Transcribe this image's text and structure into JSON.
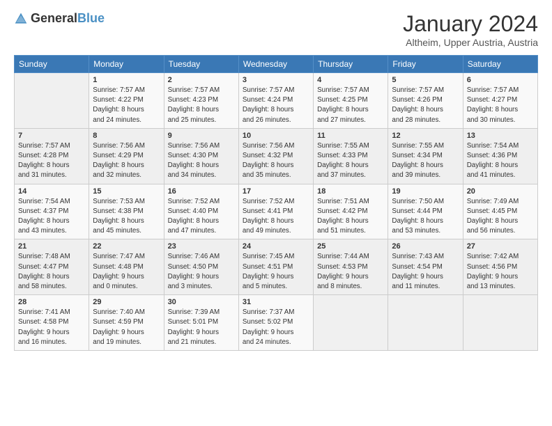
{
  "logo": {
    "general": "General",
    "blue": "Blue"
  },
  "header": {
    "month": "January 2024",
    "location": "Altheim, Upper Austria, Austria"
  },
  "weekdays": [
    "Sunday",
    "Monday",
    "Tuesday",
    "Wednesday",
    "Thursday",
    "Friday",
    "Saturday"
  ],
  "weeks": [
    [
      {
        "day": "",
        "info": ""
      },
      {
        "day": "1",
        "info": "Sunrise: 7:57 AM\nSunset: 4:22 PM\nDaylight: 8 hours\nand 24 minutes."
      },
      {
        "day": "2",
        "info": "Sunrise: 7:57 AM\nSunset: 4:23 PM\nDaylight: 8 hours\nand 25 minutes."
      },
      {
        "day": "3",
        "info": "Sunrise: 7:57 AM\nSunset: 4:24 PM\nDaylight: 8 hours\nand 26 minutes."
      },
      {
        "day": "4",
        "info": "Sunrise: 7:57 AM\nSunset: 4:25 PM\nDaylight: 8 hours\nand 27 minutes."
      },
      {
        "day": "5",
        "info": "Sunrise: 7:57 AM\nSunset: 4:26 PM\nDaylight: 8 hours\nand 28 minutes."
      },
      {
        "day": "6",
        "info": "Sunrise: 7:57 AM\nSunset: 4:27 PM\nDaylight: 8 hours\nand 30 minutes."
      }
    ],
    [
      {
        "day": "7",
        "info": "Sunrise: 7:57 AM\nSunset: 4:28 PM\nDaylight: 8 hours\nand 31 minutes."
      },
      {
        "day": "8",
        "info": "Sunrise: 7:56 AM\nSunset: 4:29 PM\nDaylight: 8 hours\nand 32 minutes."
      },
      {
        "day": "9",
        "info": "Sunrise: 7:56 AM\nSunset: 4:30 PM\nDaylight: 8 hours\nand 34 minutes."
      },
      {
        "day": "10",
        "info": "Sunrise: 7:56 AM\nSunset: 4:32 PM\nDaylight: 8 hours\nand 35 minutes."
      },
      {
        "day": "11",
        "info": "Sunrise: 7:55 AM\nSunset: 4:33 PM\nDaylight: 8 hours\nand 37 minutes."
      },
      {
        "day": "12",
        "info": "Sunrise: 7:55 AM\nSunset: 4:34 PM\nDaylight: 8 hours\nand 39 minutes."
      },
      {
        "day": "13",
        "info": "Sunrise: 7:54 AM\nSunset: 4:36 PM\nDaylight: 8 hours\nand 41 minutes."
      }
    ],
    [
      {
        "day": "14",
        "info": "Sunrise: 7:54 AM\nSunset: 4:37 PM\nDaylight: 8 hours\nand 43 minutes."
      },
      {
        "day": "15",
        "info": "Sunrise: 7:53 AM\nSunset: 4:38 PM\nDaylight: 8 hours\nand 45 minutes."
      },
      {
        "day": "16",
        "info": "Sunrise: 7:52 AM\nSunset: 4:40 PM\nDaylight: 8 hours\nand 47 minutes."
      },
      {
        "day": "17",
        "info": "Sunrise: 7:52 AM\nSunset: 4:41 PM\nDaylight: 8 hours\nand 49 minutes."
      },
      {
        "day": "18",
        "info": "Sunrise: 7:51 AM\nSunset: 4:42 PM\nDaylight: 8 hours\nand 51 minutes."
      },
      {
        "day": "19",
        "info": "Sunrise: 7:50 AM\nSunset: 4:44 PM\nDaylight: 8 hours\nand 53 minutes."
      },
      {
        "day": "20",
        "info": "Sunrise: 7:49 AM\nSunset: 4:45 PM\nDaylight: 8 hours\nand 56 minutes."
      }
    ],
    [
      {
        "day": "21",
        "info": "Sunrise: 7:48 AM\nSunset: 4:47 PM\nDaylight: 8 hours\nand 58 minutes."
      },
      {
        "day": "22",
        "info": "Sunrise: 7:47 AM\nSunset: 4:48 PM\nDaylight: 9 hours\nand 0 minutes."
      },
      {
        "day": "23",
        "info": "Sunrise: 7:46 AM\nSunset: 4:50 PM\nDaylight: 9 hours\nand 3 minutes."
      },
      {
        "day": "24",
        "info": "Sunrise: 7:45 AM\nSunset: 4:51 PM\nDaylight: 9 hours\nand 5 minutes."
      },
      {
        "day": "25",
        "info": "Sunrise: 7:44 AM\nSunset: 4:53 PM\nDaylight: 9 hours\nand 8 minutes."
      },
      {
        "day": "26",
        "info": "Sunrise: 7:43 AM\nSunset: 4:54 PM\nDaylight: 9 hours\nand 11 minutes."
      },
      {
        "day": "27",
        "info": "Sunrise: 7:42 AM\nSunset: 4:56 PM\nDaylight: 9 hours\nand 13 minutes."
      }
    ],
    [
      {
        "day": "28",
        "info": "Sunrise: 7:41 AM\nSunset: 4:58 PM\nDaylight: 9 hours\nand 16 minutes."
      },
      {
        "day": "29",
        "info": "Sunrise: 7:40 AM\nSunset: 4:59 PM\nDaylight: 9 hours\nand 19 minutes."
      },
      {
        "day": "30",
        "info": "Sunrise: 7:39 AM\nSunset: 5:01 PM\nDaylight: 9 hours\nand 21 minutes."
      },
      {
        "day": "31",
        "info": "Sunrise: 7:37 AM\nSunset: 5:02 PM\nDaylight: 9 hours\nand 24 minutes."
      },
      {
        "day": "",
        "info": ""
      },
      {
        "day": "",
        "info": ""
      },
      {
        "day": "",
        "info": ""
      }
    ]
  ]
}
